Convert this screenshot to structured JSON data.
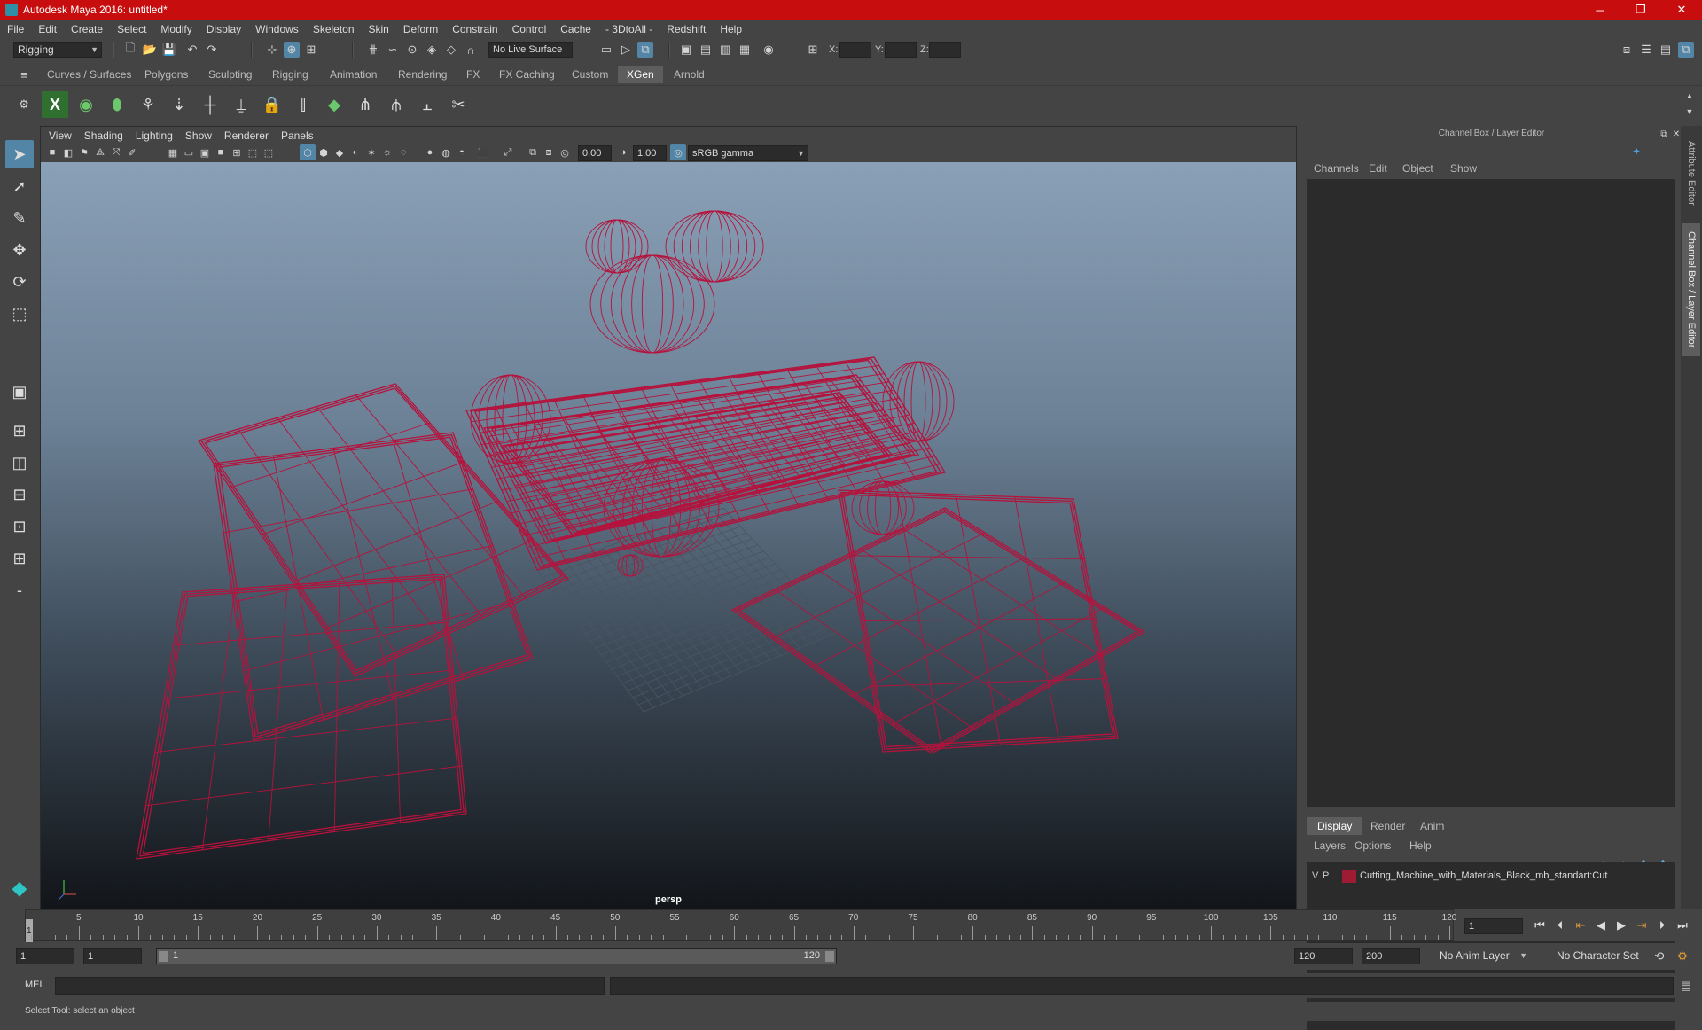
{
  "window": {
    "title": "Autodesk Maya 2016: untitled*",
    "minimize": "─",
    "maximize": "❐",
    "close": "✕"
  },
  "menubar": [
    "File",
    "Edit",
    "Create",
    "Select",
    "Modify",
    "Display",
    "Windows",
    "Skeleton",
    "Skin",
    "Deform",
    "Constrain",
    "Control",
    "Cache",
    "- 3DtoAll -",
    "Redshift",
    "Help"
  ],
  "statusline": {
    "menuset": "Rigging",
    "live_surface": "No Live Surface",
    "x_label": "X:",
    "y_label": "Y:",
    "z_label": "Z:"
  },
  "shelf_tabs": [
    "Curves / Surfaces",
    "Polygons",
    "Sculpting",
    "Rigging",
    "Animation",
    "Rendering",
    "FX",
    "FX Caching",
    "Custom",
    "XGen",
    "Arnold"
  ],
  "active_shelf_tab": "XGen",
  "viewport": {
    "menus": [
      "View",
      "Shading",
      "Lighting",
      "Show",
      "Renderer",
      "Panels"
    ],
    "exposure": "0.00",
    "gamma": "1.00",
    "color_space": "sRGB gamma",
    "camera": "persp",
    "wire_color": "#b5123c"
  },
  "right_panel": {
    "title": "Channel Box / Layer Editor",
    "channel_menus": [
      "Channels",
      "Edit",
      "Object",
      "Show"
    ],
    "layer_tabs": [
      "Display",
      "Render",
      "Anim"
    ],
    "active_layer_tab": "Display",
    "layer_menus": [
      "Layers",
      "Options",
      "Help"
    ],
    "layer": {
      "v": "V",
      "p": "P",
      "name": "Cutting_Machine_with_Materials_Black_mb_standart:Cut",
      "color": "#9e1b34"
    }
  },
  "side_tabs": [
    "Attribute Editor",
    "Channel Box / Layer Editor"
  ],
  "timeline": {
    "labels": [
      "5",
      "10",
      "15",
      "20",
      "25",
      "30",
      "35",
      "40",
      "45",
      "50",
      "55",
      "60",
      "65",
      "70",
      "75",
      "80",
      "85",
      "90",
      "95",
      "100",
      "105",
      "110",
      "115",
      "120"
    ],
    "current_marker": "1",
    "current_frame": "1"
  },
  "range": {
    "start": "1",
    "inner_start": "1",
    "slider_start": "1",
    "slider_end": "120",
    "end": "120",
    "max": "200",
    "anim_layer": "No Anim Layer",
    "character_set": "No Character Set"
  },
  "command": {
    "lang": "MEL"
  },
  "help_line": "Select Tool: select an object"
}
